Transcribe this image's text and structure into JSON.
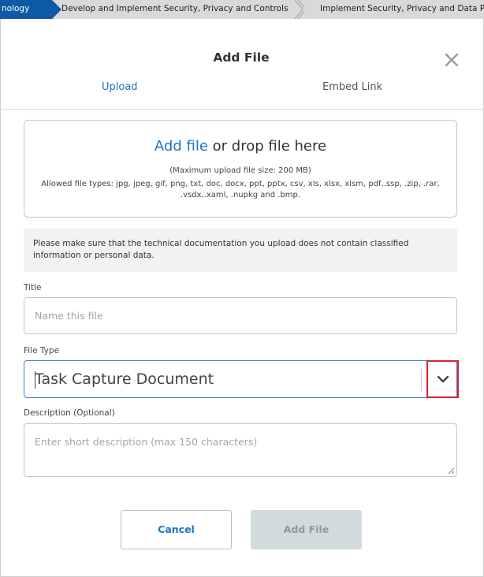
{
  "breadcrumb": {
    "items": [
      "nology",
      "Develop and Implement Security, Privacy and Controls",
      "Implement Security, Privacy and Data P"
    ]
  },
  "modal": {
    "title": "Add File",
    "close_icon": "close-icon",
    "tabs": [
      "Upload",
      "Embed Link"
    ]
  },
  "dropzone": {
    "link_text": "Add file",
    "rest_text": " or drop file here",
    "max_size": "(Maximum upload file size: 200 MB)",
    "allowed_types": "Allowed file types: jpg, jpeg, gif, png, txt, doc, docx, ppt, pptx, csv, xls, xlsx, xlsm, pdf,.ssp, .zip, .rar, .vsdx,.xaml, .nupkg and .bmp."
  },
  "notice": "Please make sure that the technical documentation you upload does not contain classified information or personal data.",
  "form": {
    "title_label": "Title",
    "title_placeholder": "Name this file",
    "title_value": "",
    "file_type_label": "File Type",
    "file_type_value": "Task Capture Document",
    "description_label": "Description (Optional)",
    "description_placeholder": "Enter short description (max 150 characters)"
  },
  "buttons": {
    "cancel": "Cancel",
    "add_file": "Add File"
  },
  "colors": {
    "accent": "#1a73c8",
    "breadcrumb_active": "#0f5aa4",
    "highlight": "#e0202a",
    "disabled_button": "#d3dade"
  }
}
